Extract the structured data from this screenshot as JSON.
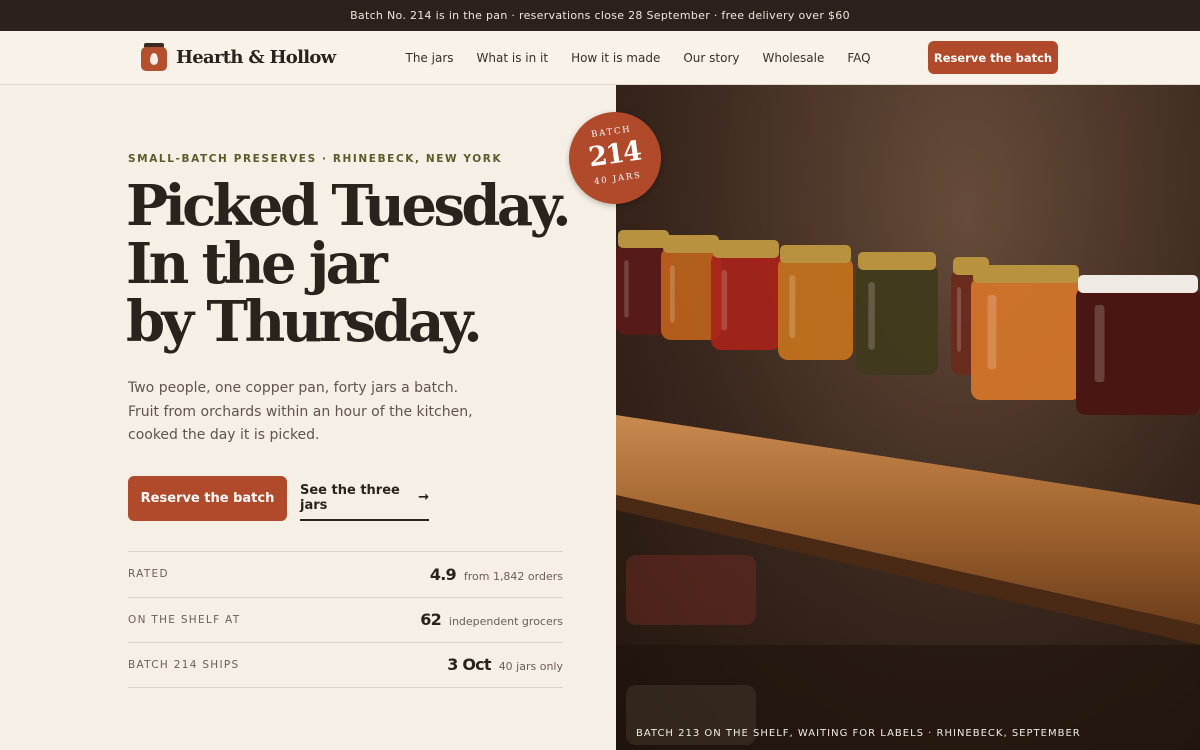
{
  "announcement": "Batch No. 214 is in the pan · reservations close 28 September · free delivery over $60",
  "brand": {
    "name": "Hearth & Hollow",
    "accent": "#b04a2a",
    "dark": "#2b221d",
    "background": "#f6efe5"
  },
  "nav": {
    "links": [
      "The jars",
      "What is in it",
      "How it is made",
      "Our story",
      "Wholesale",
      "FAQ"
    ],
    "cta": "Reserve the batch"
  },
  "hero": {
    "eyebrow": "SMALL-BATCH PRESERVES · RHINEBECK, NEW YORK",
    "headline": [
      "Picked Tuesday.",
      "In the jar",
      "by Thursday."
    ],
    "lede": "Two people, one copper pan, forty jars a batch. Fruit from orchards within an hour of the kitchen, cooked the day it is picked.",
    "primary_cta": "Reserve the batch",
    "secondary_cta": "See the three jars",
    "secondary_icon": "arrow-right-icon"
  },
  "stats": [
    {
      "label": "RATED",
      "value": "4.9",
      "note": "from 1,842 orders"
    },
    {
      "label": "ON THE SHELF AT",
      "value": "62",
      "note": "independent grocers"
    },
    {
      "label": "BATCH 214 SHIPS",
      "value": "3 Oct",
      "note": "40 jars only"
    }
  ],
  "badge": {
    "top": "BATCH",
    "number": "214",
    "bottom": "40 JARS"
  },
  "photo": {
    "caption": "BATCH 213 ON THE SHELF, WAITING FOR LABELS · RHINEBECK, SEPTEMBER",
    "jar_colors": [
      "#5a1a18",
      "#c0641c",
      "#a8221a",
      "#c8741e",
      "#3f3a1c",
      "#6a2a1c",
      "#d8782a",
      "#4a1612"
    ]
  }
}
